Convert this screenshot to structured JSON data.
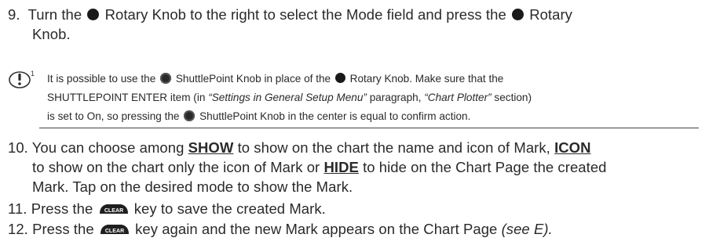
{
  "step9": {
    "num": "9.",
    "p1": "Turn the",
    "p2": "Rotary Knob to the right to select the Mode field and press the",
    "p3": "Rotary",
    "p4": "Knob."
  },
  "note": {
    "icon": "caution-info-icon",
    "l1a": "It is possible to use the",
    "l1b": "ShuttlePoint Knob in place of the",
    "l1c": "Rotary Knob. Make sure that the",
    "l2a": "SHUTTLEPOINT ENTER item (in",
    "l2b": "“Settings in General Setup Menu”",
    "l2c": "paragraph,",
    "l2d": "“Chart Plotter”",
    "l2e": "section)",
    "l3a": "is set to On, so pressing the",
    "l3b": "ShuttlePoint Knob in the center is equal to confirm action."
  },
  "step10": {
    "num": "10.",
    "a": "You can choose among",
    "show": "SHOW",
    "b": "to show on the chart the name and icon of Mark,",
    "icon": "ICON",
    "c": "to show on the chart only the icon of Mark or",
    "hide": "HIDE",
    "d": "to hide on the Chart Page the created",
    "e": "Mark. Tap on the desired mode to show the Mark."
  },
  "step11": {
    "num": "11.",
    "a": "Press the",
    "key": "CLEAR",
    "b": "key to save the created Mark."
  },
  "step12": {
    "num": "12.",
    "a": "Press the",
    "key": "CLEAR",
    "b": "key again and the new Mark appears on the Chart Page",
    "c": "(see E)."
  }
}
